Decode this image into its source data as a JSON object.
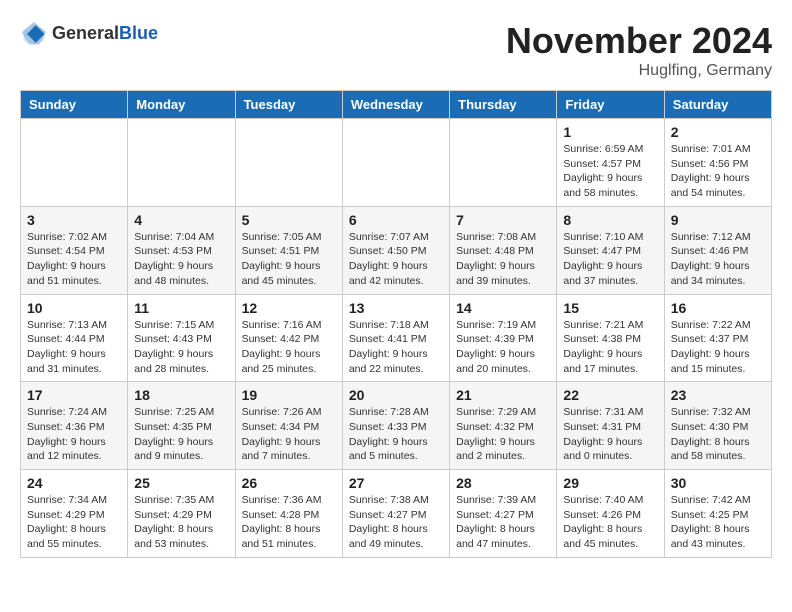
{
  "logo": {
    "general": "General",
    "blue": "Blue"
  },
  "header": {
    "month_title": "November 2024",
    "location": "Huglfing, Germany"
  },
  "weekdays": [
    "Sunday",
    "Monday",
    "Tuesday",
    "Wednesday",
    "Thursday",
    "Friday",
    "Saturday"
  ],
  "weeks": [
    [
      {
        "day": "",
        "info": ""
      },
      {
        "day": "",
        "info": ""
      },
      {
        "day": "",
        "info": ""
      },
      {
        "day": "",
        "info": ""
      },
      {
        "day": "",
        "info": ""
      },
      {
        "day": "1",
        "info": "Sunrise: 6:59 AM\nSunset: 4:57 PM\nDaylight: 9 hours and 58 minutes."
      },
      {
        "day": "2",
        "info": "Sunrise: 7:01 AM\nSunset: 4:56 PM\nDaylight: 9 hours and 54 minutes."
      }
    ],
    [
      {
        "day": "3",
        "info": "Sunrise: 7:02 AM\nSunset: 4:54 PM\nDaylight: 9 hours and 51 minutes."
      },
      {
        "day": "4",
        "info": "Sunrise: 7:04 AM\nSunset: 4:53 PM\nDaylight: 9 hours and 48 minutes."
      },
      {
        "day": "5",
        "info": "Sunrise: 7:05 AM\nSunset: 4:51 PM\nDaylight: 9 hours and 45 minutes."
      },
      {
        "day": "6",
        "info": "Sunrise: 7:07 AM\nSunset: 4:50 PM\nDaylight: 9 hours and 42 minutes."
      },
      {
        "day": "7",
        "info": "Sunrise: 7:08 AM\nSunset: 4:48 PM\nDaylight: 9 hours and 39 minutes."
      },
      {
        "day": "8",
        "info": "Sunrise: 7:10 AM\nSunset: 4:47 PM\nDaylight: 9 hours and 37 minutes."
      },
      {
        "day": "9",
        "info": "Sunrise: 7:12 AM\nSunset: 4:46 PM\nDaylight: 9 hours and 34 minutes."
      }
    ],
    [
      {
        "day": "10",
        "info": "Sunrise: 7:13 AM\nSunset: 4:44 PM\nDaylight: 9 hours and 31 minutes."
      },
      {
        "day": "11",
        "info": "Sunrise: 7:15 AM\nSunset: 4:43 PM\nDaylight: 9 hours and 28 minutes."
      },
      {
        "day": "12",
        "info": "Sunrise: 7:16 AM\nSunset: 4:42 PM\nDaylight: 9 hours and 25 minutes."
      },
      {
        "day": "13",
        "info": "Sunrise: 7:18 AM\nSunset: 4:41 PM\nDaylight: 9 hours and 22 minutes."
      },
      {
        "day": "14",
        "info": "Sunrise: 7:19 AM\nSunset: 4:39 PM\nDaylight: 9 hours and 20 minutes."
      },
      {
        "day": "15",
        "info": "Sunrise: 7:21 AM\nSunset: 4:38 PM\nDaylight: 9 hours and 17 minutes."
      },
      {
        "day": "16",
        "info": "Sunrise: 7:22 AM\nSunset: 4:37 PM\nDaylight: 9 hours and 15 minutes."
      }
    ],
    [
      {
        "day": "17",
        "info": "Sunrise: 7:24 AM\nSunset: 4:36 PM\nDaylight: 9 hours and 12 minutes."
      },
      {
        "day": "18",
        "info": "Sunrise: 7:25 AM\nSunset: 4:35 PM\nDaylight: 9 hours and 9 minutes."
      },
      {
        "day": "19",
        "info": "Sunrise: 7:26 AM\nSunset: 4:34 PM\nDaylight: 9 hours and 7 minutes."
      },
      {
        "day": "20",
        "info": "Sunrise: 7:28 AM\nSunset: 4:33 PM\nDaylight: 9 hours and 5 minutes."
      },
      {
        "day": "21",
        "info": "Sunrise: 7:29 AM\nSunset: 4:32 PM\nDaylight: 9 hours and 2 minutes."
      },
      {
        "day": "22",
        "info": "Sunrise: 7:31 AM\nSunset: 4:31 PM\nDaylight: 9 hours and 0 minutes."
      },
      {
        "day": "23",
        "info": "Sunrise: 7:32 AM\nSunset: 4:30 PM\nDaylight: 8 hours and 58 minutes."
      }
    ],
    [
      {
        "day": "24",
        "info": "Sunrise: 7:34 AM\nSunset: 4:29 PM\nDaylight: 8 hours and 55 minutes."
      },
      {
        "day": "25",
        "info": "Sunrise: 7:35 AM\nSunset: 4:29 PM\nDaylight: 8 hours and 53 minutes."
      },
      {
        "day": "26",
        "info": "Sunrise: 7:36 AM\nSunset: 4:28 PM\nDaylight: 8 hours and 51 minutes."
      },
      {
        "day": "27",
        "info": "Sunrise: 7:38 AM\nSunset: 4:27 PM\nDaylight: 8 hours and 49 minutes."
      },
      {
        "day": "28",
        "info": "Sunrise: 7:39 AM\nSunset: 4:27 PM\nDaylight: 8 hours and 47 minutes."
      },
      {
        "day": "29",
        "info": "Sunrise: 7:40 AM\nSunset: 4:26 PM\nDaylight: 8 hours and 45 minutes."
      },
      {
        "day": "30",
        "info": "Sunrise: 7:42 AM\nSunset: 4:25 PM\nDaylight: 8 hours and 43 minutes."
      }
    ]
  ]
}
